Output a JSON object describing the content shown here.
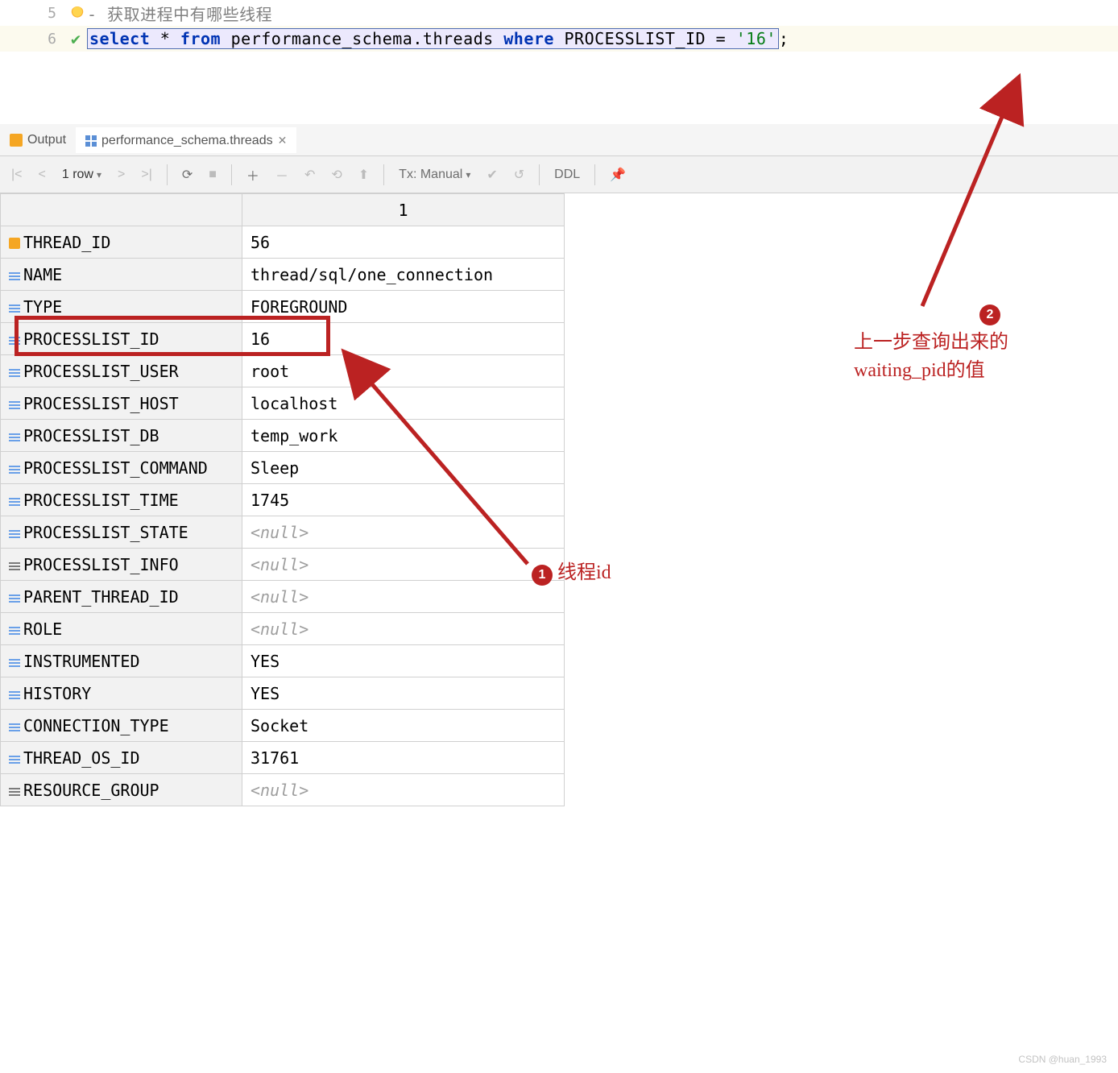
{
  "editor": {
    "line5": {
      "num": "5",
      "comment": "获取进程中有哪些线程"
    },
    "line6": {
      "num": "6",
      "tokens": {
        "select": "select",
        "star": "*",
        "from": "from",
        "schema": "performance_schema",
        "dot": ".",
        "table": "threads",
        "where": "where",
        "col": "PROCESSLIST_ID",
        "eq": "=",
        "val": "'16'",
        "semi": ";"
      }
    }
  },
  "tabs": {
    "output": "Output",
    "active": "performance_schema.threads"
  },
  "toolbar": {
    "row_count": "1 row",
    "tx_label": "Tx: Manual",
    "ddl": "DDL"
  },
  "result_header": "1",
  "rows": [
    {
      "icon": "pk",
      "field": "THREAD_ID",
      "value": "56",
      "null": false
    },
    {
      "icon": "blue",
      "field": "NAME",
      "value": "thread/sql/one_connection",
      "null": false
    },
    {
      "icon": "blue",
      "field": "TYPE",
      "value": "FOREGROUND",
      "null": false
    },
    {
      "icon": "blue",
      "field": "PROCESSLIST_ID",
      "value": "16",
      "null": false
    },
    {
      "icon": "blue",
      "field": "PROCESSLIST_USER",
      "value": "root",
      "null": false
    },
    {
      "icon": "blue",
      "field": "PROCESSLIST_HOST",
      "value": "localhost",
      "null": false
    },
    {
      "icon": "blue",
      "field": "PROCESSLIST_DB",
      "value": "temp_work",
      "null": false
    },
    {
      "icon": "blue",
      "field": "PROCESSLIST_COMMAND",
      "value": "Sleep",
      "null": false
    },
    {
      "icon": "blue",
      "field": "PROCESSLIST_TIME",
      "value": "1745",
      "null": false
    },
    {
      "icon": "blue",
      "field": "PROCESSLIST_STATE",
      "value": "<null>",
      "null": true
    },
    {
      "icon": "grey",
      "field": "PROCESSLIST_INFO",
      "value": "<null>",
      "null": true
    },
    {
      "icon": "blue",
      "field": "PARENT_THREAD_ID",
      "value": "<null>",
      "null": true
    },
    {
      "icon": "blue",
      "field": "ROLE",
      "value": "<null>",
      "null": true
    },
    {
      "icon": "blue",
      "field": "INSTRUMENTED",
      "value": "YES",
      "null": false
    },
    {
      "icon": "blue",
      "field": "HISTORY",
      "value": "YES",
      "null": false
    },
    {
      "icon": "blue",
      "field": "CONNECTION_TYPE",
      "value": "Socket",
      "null": false
    },
    {
      "icon": "blue",
      "field": "THREAD_OS_ID",
      "value": "31761",
      "null": false
    },
    {
      "icon": "grey",
      "field": "RESOURCE_GROUP",
      "value": "<null>",
      "null": true
    }
  ],
  "annotations": {
    "a1": {
      "num": "1",
      "text": "线程id"
    },
    "a2": {
      "num": "2",
      "text1": "上一步查询出来的",
      "text2": "waiting_pid的值"
    }
  },
  "watermark": "CSDN @huan_1993"
}
